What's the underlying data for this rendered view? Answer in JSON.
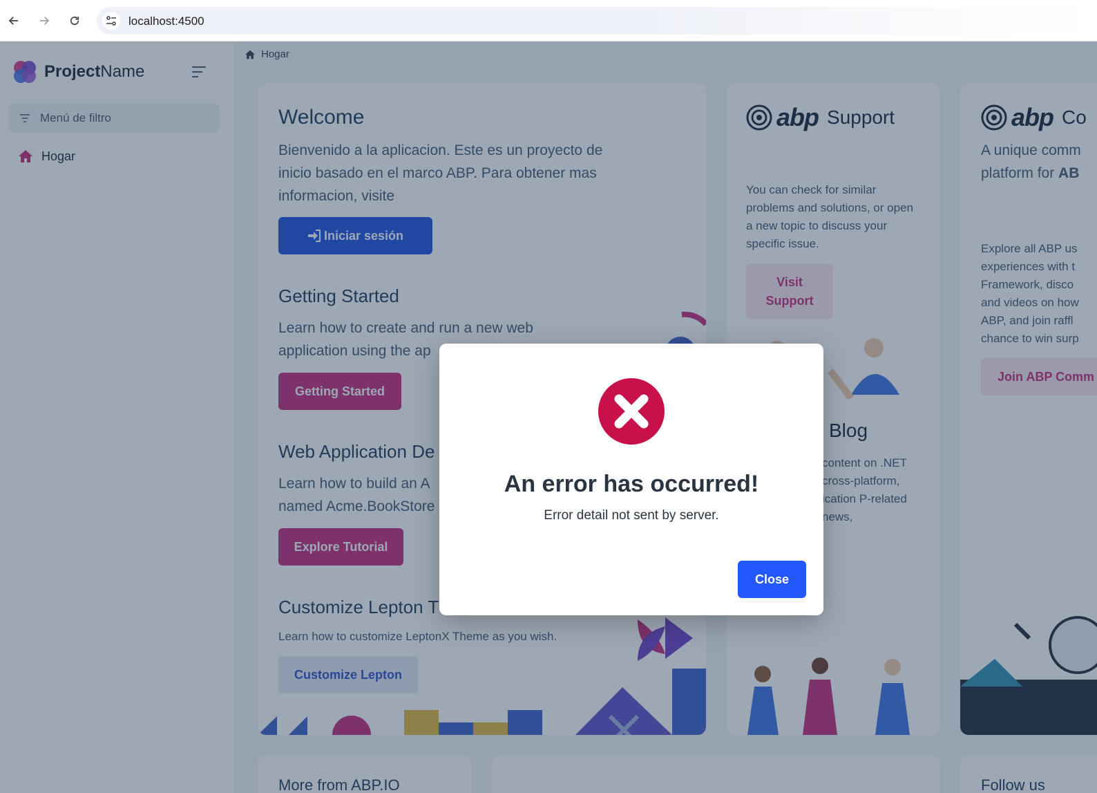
{
  "browser": {
    "url": "localhost:4500",
    "icons": {
      "back": "arrow-left-icon",
      "forward": "arrow-right-icon",
      "reload": "reload-icon",
      "site": "site-settings-icon"
    }
  },
  "sidebar": {
    "brand_bold": "Project",
    "brand_light": "Name",
    "filter_placeholder": "Menú de filtro",
    "items": [
      {
        "label": "Hogar",
        "icon": "home-icon"
      }
    ]
  },
  "breadcrumb": {
    "label": "Hogar",
    "icon": "home-icon"
  },
  "welcome": {
    "title": "Welcome",
    "text": "Bienvenido a la aplicacion. Este es un proyecto de inicio basado en el marco ABP. Para obtener mas informacion, visite",
    "login_label": "Iniciar sesión",
    "getting_started_title": "Getting Started",
    "getting_started_text": "Learn how to create and run a new web application using the ap",
    "getting_started_button": "Getting Started",
    "webapp_title": "Web Application De",
    "webapp_text": "Learn how to build an A named Acme.BookStore",
    "webapp_button": "Explore Tutorial",
    "customize_title": "Customize Lepton T",
    "customize_text": "Learn how to customize LeptonX Theme as you wish.",
    "customize_button": "Customize Lepton"
  },
  "support": {
    "brand": "abp",
    "title": "Support",
    "text": "You can check for similar problems and solutions, or open a new topic to discuss your specific issue.",
    "button": "Visit Support"
  },
  "blog": {
    "title": "Blog",
    "text": "content on .NET cross-platform, ication P-related news,"
  },
  "community": {
    "brand": "abp",
    "title": "Co",
    "lead_1": "A unique comm",
    "lead_2": "platform for",
    "lead_bold": "AB",
    "text": "Explore all ABP us experiences with t Framework, disco and videos on how ABP, and join raffl chance to win surp",
    "button": "Join ABP Comm"
  },
  "bottom": {
    "more_title": "More from ABP.IO",
    "follow_title": "Follow us"
  },
  "modal": {
    "icon": "error-x-icon",
    "title": "An error has occurred!",
    "detail": "Error detail not sent by server.",
    "close_label": "Close"
  },
  "colors": {
    "primary": "#1a4fdc",
    "pink": "#c4287a",
    "error": "#c8104b",
    "close_button": "#2458ff",
    "overlay": "rgba(40,62,88,0.45)"
  }
}
